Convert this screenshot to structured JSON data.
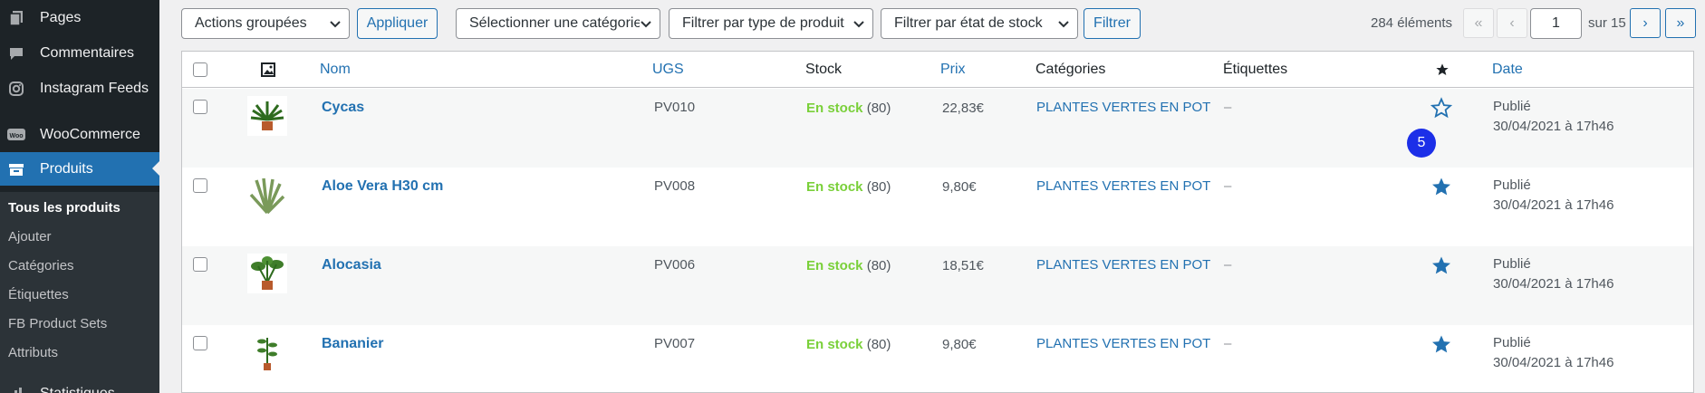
{
  "sidebar": {
    "items": [
      {
        "label": "Pages",
        "icon": "pages-icon"
      },
      {
        "label": "Commentaires",
        "icon": "comments-icon"
      },
      {
        "label": "Instagram Feeds",
        "icon": "instagram-icon"
      },
      {
        "label": "WooCommerce",
        "icon": "woocommerce-icon"
      },
      {
        "label": "Produits",
        "icon": "products-icon"
      },
      {
        "label": "Statistiques",
        "icon": "stats-icon"
      }
    ],
    "submenu": [
      "Tous les produits",
      "Ajouter",
      "Catégories",
      "Étiquettes",
      "FB Product Sets",
      "Attributs"
    ]
  },
  "toolbar": {
    "bulk_actions": "Actions groupées",
    "apply": "Appliquer",
    "category_filter": "Sélectionner une catégorie",
    "type_filter": "Filtrer par type de produit",
    "stock_filter": "Filtrer par état de stock",
    "filter": "Filtrer"
  },
  "pagination": {
    "count": "284 éléments",
    "first": "«",
    "prev": "‹",
    "current_page": "1",
    "of_label": "sur 15",
    "next": "›",
    "last": "»"
  },
  "table": {
    "headers": {
      "name": "Nom",
      "sku": "UGS",
      "stock": "Stock",
      "price": "Prix",
      "categories": "Catégories",
      "tags": "Étiquettes",
      "featured_icon": "star-icon",
      "date": "Date"
    },
    "rows": [
      {
        "name": "Cycas",
        "sku": "PV010",
        "stock_status": "En stock",
        "stock_qty": "(80)",
        "price": "22,83€",
        "category": "PLANTES VERTES EN POT",
        "tags": "–",
        "featured": false,
        "date_status": "Publié",
        "date": "30/04/2021 à 17h46"
      },
      {
        "name": "Aloe Vera H30 cm",
        "sku": "PV008",
        "stock_status": "En stock",
        "stock_qty": "(80)",
        "price": "9,80€",
        "category": "PLANTES VERTES EN POT",
        "tags": "–",
        "featured": true,
        "date_status": "Publié",
        "date": "30/04/2021 à 17h46"
      },
      {
        "name": "Alocasia",
        "sku": "PV006",
        "stock_status": "En stock",
        "stock_qty": "(80)",
        "price": "18,51€",
        "category": "PLANTES VERTES EN POT",
        "tags": "–",
        "featured": true,
        "date_status": "Publié",
        "date": "30/04/2021 à 17h46"
      },
      {
        "name": "Bananier",
        "sku": "PV007",
        "stock_status": "En stock",
        "stock_qty": "(80)",
        "price": "9,80€",
        "category": "PLANTES VERTES EN POT",
        "tags": "–",
        "featured": true,
        "date_status": "Publié",
        "date": "30/04/2021 à 17h46"
      }
    ]
  },
  "annotation_badge": "5",
  "colors": {
    "accent": "#2271b1",
    "sidebar": "#1d2327",
    "in_stock": "#7ad03a",
    "badge": "#1c2fe8"
  }
}
